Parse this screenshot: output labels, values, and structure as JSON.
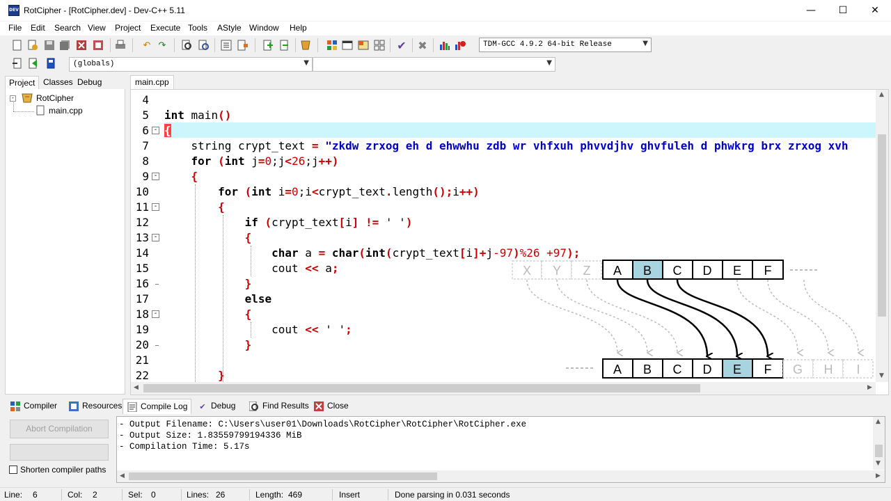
{
  "window": {
    "title": "RotCipher - [RotCipher.dev] - Dev-C++ 5.11",
    "icon_label": "DEV",
    "minimize": "—",
    "maximize": "☐",
    "close": "✕"
  },
  "menu": [
    "File",
    "Edit",
    "Search",
    "View",
    "Project",
    "Execute",
    "Tools",
    "AStyle",
    "Window",
    "Help"
  ],
  "toolbar": {
    "compiler": "TDM-GCC 4.9.2 64-bit Release",
    "scope": "(globals)",
    "symbol": ""
  },
  "left_panel": {
    "tabs": [
      "Project",
      "Classes",
      "Debug"
    ],
    "active_tab": "Project",
    "project_name": "RotCipher",
    "files": [
      "main.cpp"
    ]
  },
  "editor": {
    "tab": "main.cpp",
    "line_numbers": [
      "4",
      "5",
      "6",
      "7",
      "8",
      "9",
      "10",
      "11",
      "12",
      "13",
      "14",
      "15",
      "16",
      "17",
      "18",
      "19",
      "20",
      "21",
      "22"
    ]
  },
  "code": {
    "l5_kw": "int",
    "l5_rest": " main",
    "l5_paren": "()",
    "l6_brace": "{",
    "l7_type": "string crypt_text ",
    "l7_eq": "=",
    "l7_str": " \"zkdw zrxog eh d ehwwhu zdb wr vhfxuh phvvdjhv ghvfuleh d phwkrg brx zrxog xvh",
    "l8_for": "for",
    "l8_p1": " (",
    "l8_int": "int",
    "l8_a": " j",
    "l8_eq": "=",
    "l8_zero": "0",
    "l8_b": ";j",
    "l8_lt": "<",
    "l8_26": "26",
    "l8_c": ";j",
    "l8_pp": "++)",
    "l9_brace": "{",
    "l10_for": "for",
    "l10_p1": " (",
    "l10_int": "int",
    "l10_a": " i",
    "l10_eq": "=",
    "l10_zero": "0",
    "l10_b": ";i",
    "l10_lt": "<",
    "l10_c": "crypt_text",
    "l10_dot": ".",
    "l10_d": "length",
    "l10_e": "();",
    "l10_f": "i",
    "l10_pp": "++)",
    "l11_brace": "{",
    "l12_if": "if",
    "l12_p1": " (",
    "l12_a": "crypt_text",
    "l12_b1": "[",
    "l12_i": "i",
    "l12_b2": "]",
    "l12_ne": " != ",
    "l12_s": "' '",
    "l12_p2": ")",
    "l13_brace": "{",
    "l14_char": "char",
    "l14_a": " a ",
    "l14_eq": "=",
    "l14_char2": " char",
    "l14_p1": "(",
    "l14_int": "int",
    "l14_p2": "(",
    "l14_b": "crypt_text",
    "l14_br1": "[",
    "l14_i": "i",
    "l14_br2": "]+",
    "l14_j": "j",
    "l14_m": "-97",
    "l14_p3": ")",
    "l14_mod": "%26 +97",
    "l14_end": ");",
    "l15_cout": "cout ",
    "l15_op": "<<",
    "l15_a": " a",
    "l15_semi": ";",
    "l16_brace": "}",
    "l17_else": "else",
    "l18_brace": "{",
    "l19_cout": "cout ",
    "l19_op": "<<",
    "l19_sp": " ' '",
    "l19_semi": ";",
    "l20_brace": "}",
    "l22_brace": "}"
  },
  "diagram": {
    "top_faded": [
      "X",
      "Y",
      "Z"
    ],
    "top": [
      "A",
      "B",
      "C",
      "D",
      "E",
      "F"
    ],
    "bottom": [
      "A",
      "B",
      "C",
      "D",
      "E",
      "F"
    ],
    "bottom_faded": [
      "G",
      "H",
      "I"
    ],
    "highlight_top": "B",
    "highlight_bottom": "E",
    "highlight_color": "#a8d4e0"
  },
  "bottom_panel": {
    "tabs": [
      "Compiler",
      "Resources",
      "Compile Log",
      "Debug",
      "Find Results",
      "Close"
    ],
    "active_tab": "Compile Log",
    "abort_button": "Abort Compilation",
    "shorten_label": "Shorten compiler paths",
    "log": [
      "- Output Filename: C:\\Users\\user01\\Downloads\\RotCipher\\RotCipher\\RotCipher.exe",
      "- Output Size: 1.83559799194336 MiB",
      "- Compilation Time: 5.17s"
    ]
  },
  "status": {
    "line_label": "Line:",
    "line": "6",
    "col_label": "Col:",
    "col": "2",
    "sel_label": "Sel:",
    "sel": "0",
    "lines_label": "Lines:",
    "lines": "26",
    "length_label": "Length:",
    "length": "469",
    "mode": "Insert",
    "message": "Done parsing in 0.031 seconds"
  }
}
